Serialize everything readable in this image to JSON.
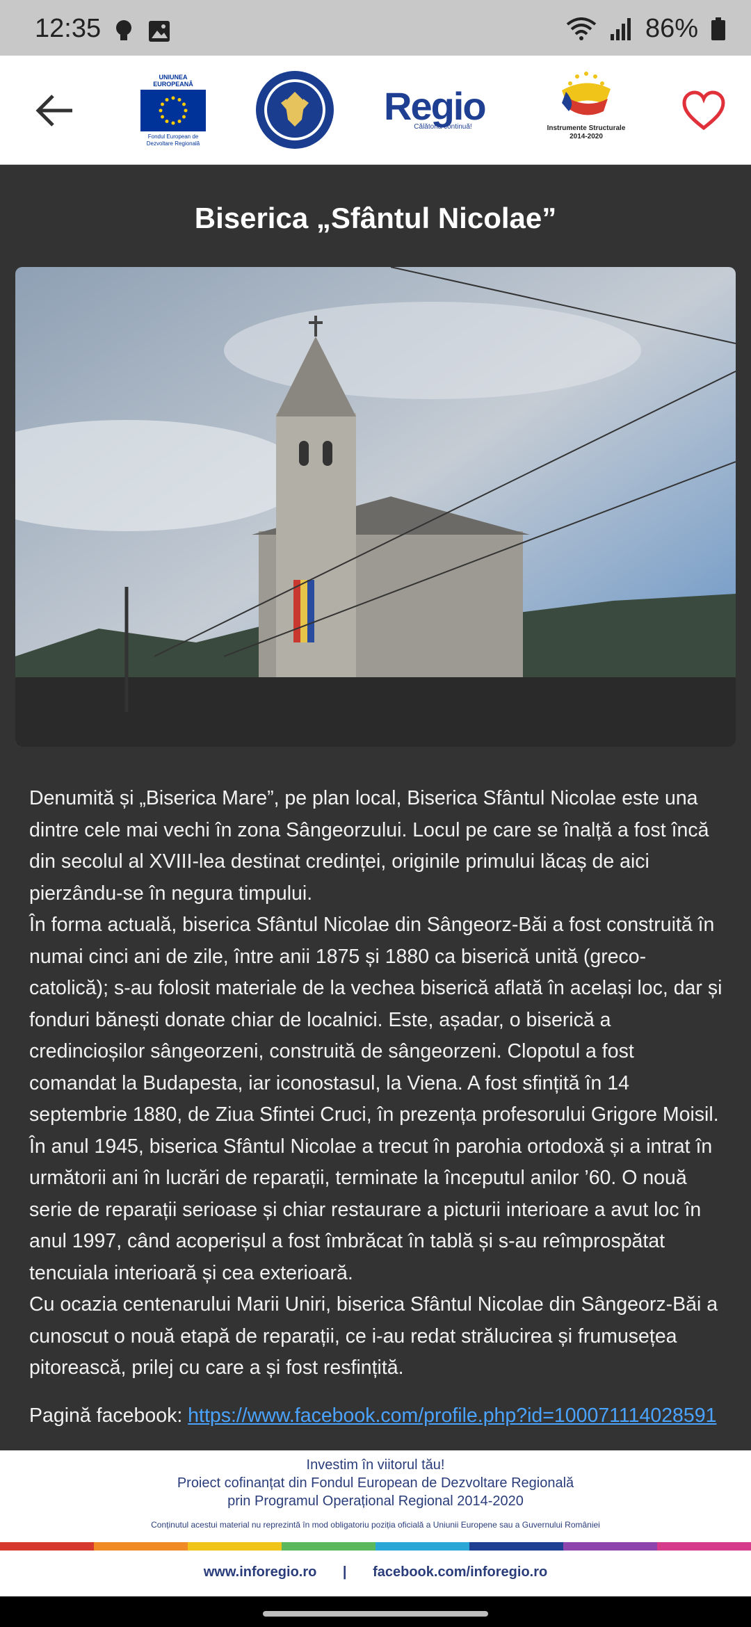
{
  "status_bar": {
    "time": "12:35",
    "battery": "86%"
  },
  "header": {
    "eu_caption": "UNIUNEA EUROPEANĂ",
    "eu_sub1": "Fondul European de",
    "eu_sub2": "Dezvoltare Regională",
    "gov_text": "GUVERNUL ROMÂNIEI",
    "regio_word": "Regio",
    "regio_tag": "Călătoria continuă!",
    "is_text1": "Instrumente Structurale",
    "is_text2": "2014-2020"
  },
  "title": "Biserica „Sfântul Nicolae”",
  "article": {
    "p1": "Denumită și „Biserica Mare”, pe plan local, Biserica Sfântul Nicolae este una dintre cele mai vechi în zona Sângeorzului. Locul pe care se înalță a fost încă din secolul al XVIII-lea destinat credinței, originile primului lăcaș de aici pierzându-se în negura timpului.",
    "p2": "În forma actuală, biserica Sfântul Nicolae din Sângeorz-Băi a fost construită în numai cinci ani de zile, între anii 1875 și 1880 ca biserică unită (greco-catolică); s-au folosit materiale de la vechea biserică aflată în același loc, dar și fonduri bănești donate chiar de localnici. Este, așadar, o biserică a credincioșilor sângeorzeni, construită de sângeorzeni. Clopotul a fost comandat la Budapesta, iar iconostasul, la Viena. A fost sfințită în 14 septembrie 1880, de Ziua Sfintei Cruci, în prezența profesorului Grigore Moisil.",
    "p3": "În anul 1945, biserica Sfântul Nicolae a trecut în parohia ortodoxă și a intrat în următorii ani în lucrări de reparații, terminate la începutul anilor ’60. O nouă serie de reparații serioase și chiar restaurare a picturii interioare a avut loc în anul 1997, când acoperișul a fost îmbrăcat în tablă și s-au reîmprospătat tencuiala interioară și cea exterioară.",
    "p4": "Cu ocazia centenarului Marii Uniri, biserica Sfântul Nicolae din Sângeorz-Băi a cunoscut o nouă etapă de reparații, ce i-au redat strălucirea și frumusețea pitorească, prilej cu care a și fost resfințită.",
    "fb_label": "Pagină facebook: ",
    "fb_url": "https://www.facebook.com/profile.php?id=100071114028591"
  },
  "footer": {
    "line1": "Investim în viitorul tău!",
    "line2": "Proiect cofinanțat din Fondul European de Dezvoltare Regională",
    "line3": "prin Programul Operațional Regional 2014-2020",
    "disclaimer": "Conținutul acestui material nu reprezintă în mod obligatoriu poziția oficială a Uniunii Europene sau a Guvernului României",
    "link1": "www.inforegio.ro",
    "separator": "|",
    "link2": "facebook.com/inforegio.ro"
  },
  "colors": {
    "background": "#333333",
    "heart": "#e0303a",
    "link": "#4aa3ff"
  },
  "icons": [
    "back-arrow-icon",
    "heart-icon",
    "bulb-icon",
    "image-icon",
    "wifi-icon",
    "signal-icon",
    "battery-icon"
  ]
}
